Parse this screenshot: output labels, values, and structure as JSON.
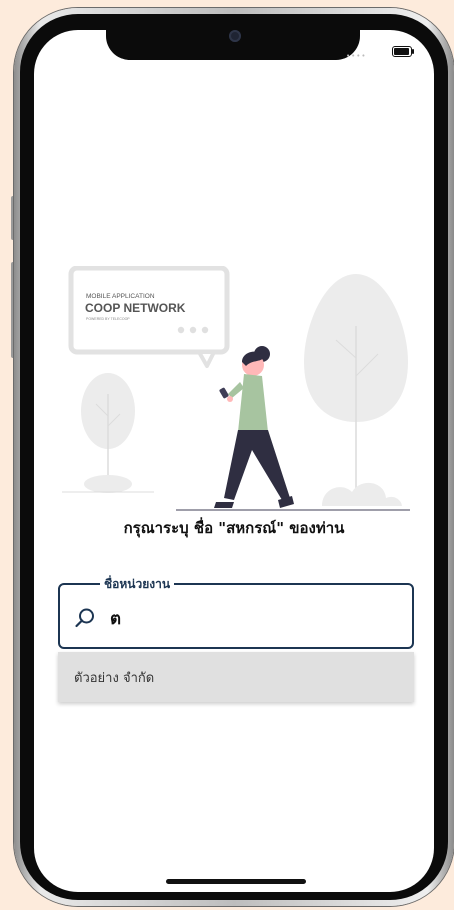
{
  "status_bar": {
    "signal_dots": "••••"
  },
  "illustration": {
    "bubble_line1": "MOBILE APPLICATION",
    "bubble_line2": "COOP NETWORK",
    "bubble_line3": "POWERED BY TELECOOP"
  },
  "prompt": "กรุณาระบุ ชื่อ \"สหกรณ์\" ของท่าน",
  "search": {
    "label": "ชื่อหน่วยงาน",
    "value": "ต"
  },
  "suggestions": [
    "ตัวอย่าง จำกัด"
  ],
  "colors": {
    "accent": "#1c3552",
    "background": "#fdebdc"
  }
}
